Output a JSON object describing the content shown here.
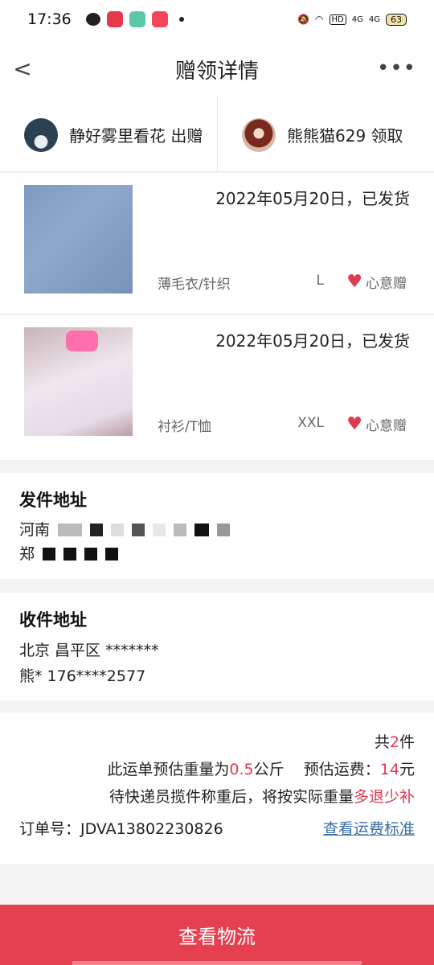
{
  "status": {
    "time": "17:36",
    "icons": [
      "wechat-icon",
      "app-red-icon",
      "app-green-icon",
      "app-video-icon",
      "dot-icon"
    ],
    "right_icons": [
      "mute-icon",
      "wifi-icon",
      "hd-icon",
      "signal-4g-icon",
      "signal-4g-icon-2"
    ],
    "hd": "HD",
    "sig1": "4G",
    "sig2": "4G",
    "battery": "63"
  },
  "nav": {
    "back": "<",
    "title": "赠领详情",
    "more": "•••"
  },
  "parties": [
    {
      "name": "静好雾里看花 出赠"
    },
    {
      "name": "熊熊猫629 领取"
    }
  ],
  "items": [
    {
      "date": "2022年05月20日，已发货",
      "category": "薄毛衣/针织",
      "size": "L",
      "tag": "心意赠"
    },
    {
      "date": "2022年05月20日，已发货",
      "category": "衬衫/T恤",
      "size": "XXL",
      "tag": "心意赠"
    }
  ],
  "send": {
    "title": "发件地址",
    "line1_start": "河南",
    "line2_start": "郑"
  },
  "receive": {
    "title": "收件地址",
    "line1": "北京 昌平区 *******",
    "line2": "熊* 176****2577"
  },
  "summary": {
    "count_prefix": "共",
    "count": "2",
    "count_suffix": "件",
    "weight_prefix": "此运单预估重量为",
    "weight": "0.5",
    "weight_unit": "公斤",
    "fee_label": "预估运费：",
    "fee": "14",
    "fee_unit": "元",
    "note_prefix": "待快递员揽件称重后，将按实际重量",
    "note_red": "多退少补",
    "order_label": "订单号：JDVA13802230826",
    "order_link": "查看运费标准"
  },
  "footer": {
    "button": "查看物流"
  },
  "colors": {
    "accent": "#e5404f",
    "red_text": "#e03a4f",
    "link": "#3a6ea5"
  }
}
